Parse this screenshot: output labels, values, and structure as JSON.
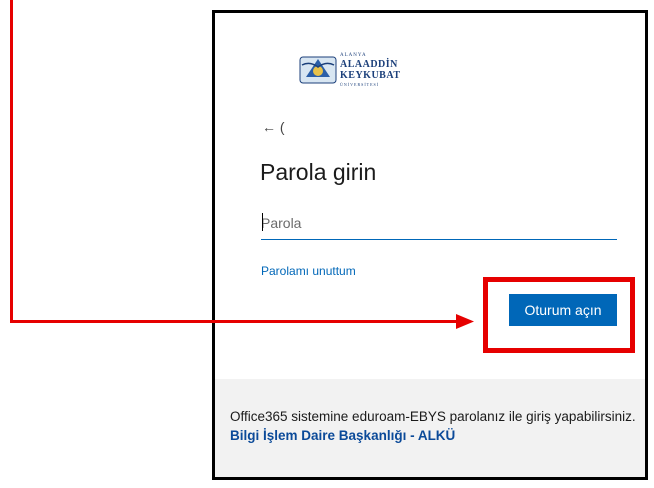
{
  "logo": {
    "line1": "ALANYA",
    "line2": "ALAADDİN",
    "line3": "KEYKUBAT",
    "line4": "ÜNİVERSİTESİ"
  },
  "back": {
    "icon": "arrow-left-icon",
    "text": "←  ("
  },
  "title": "Parola girin",
  "password": {
    "placeholder": "Parola",
    "value": ""
  },
  "forgot_link": "Parolamı unuttum",
  "signin_button": "Oturum açın",
  "footer": {
    "text": "Office365 sistemine eduroam-EBYS parolanız ile giriş yapabilirsiniz.",
    "link": "Bilgi İşlem Daire Başkanlığı - ALKÜ"
  },
  "colors": {
    "accent": "#0067b8",
    "annotation": "#e60000",
    "footer_bg": "#f2f2f2"
  }
}
